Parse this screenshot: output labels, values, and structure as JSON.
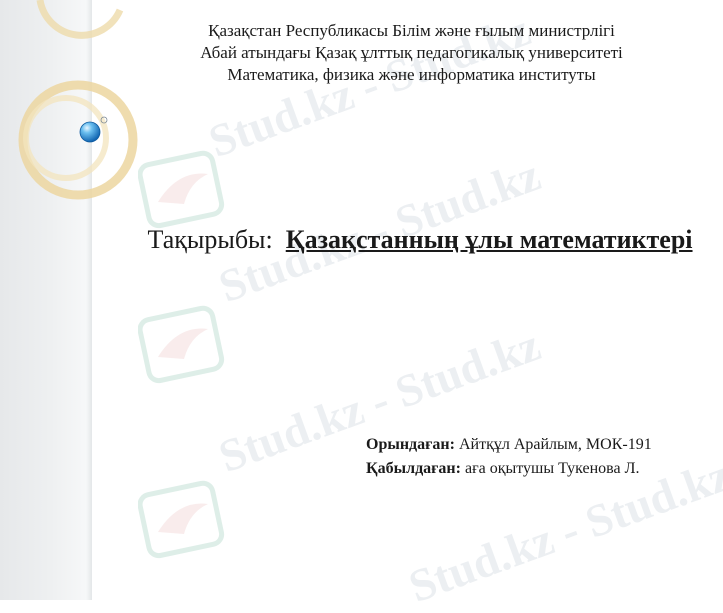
{
  "header": {
    "line1": "Қазақстан  Республикасы Білім және ғылым министрлігі",
    "line2": "Абай атындағы Қазақ ұлттық педагогикалық университеті",
    "line3": "Математика, физика  және информатика институты"
  },
  "topic": {
    "label": "Тақырыбы:",
    "title": "Қазақстанның ұлы математиктері"
  },
  "credits": {
    "performer_label": "Орындаған:",
    "performer_value": " Айтқұл Арайлым,  МОК-191",
    "reviewer_label": "Қабылдаған:",
    "reviewer_value": " аға оқытушы Тукенова Л."
  },
  "watermark": {
    "text": "Stud.kz - Stud.kz"
  },
  "colors": {
    "watermark": "#aab6c4",
    "ring": "#e8cf92",
    "orb": "#2a8fd6"
  }
}
